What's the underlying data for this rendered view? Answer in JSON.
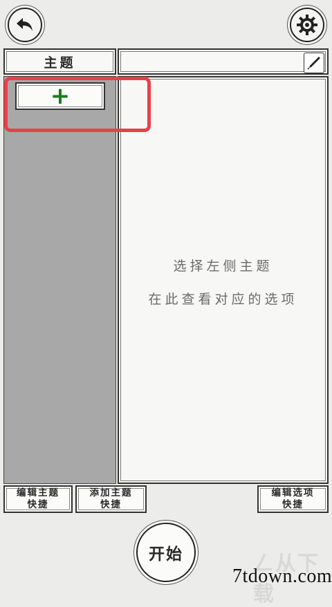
{
  "theme_panel": {
    "header": "主题",
    "add_button": "+"
  },
  "options_panel": {
    "hint_line1": "选择左侧主题",
    "hint_line2": "在此查看对应的选项"
  },
  "quick_buttons": {
    "edit_theme": {
      "line1": "编辑主题",
      "line2": "快捷"
    },
    "add_theme": {
      "line1": "添加主题",
      "line2": "快捷"
    },
    "edit_option": {
      "line1": "编辑选项",
      "line2": "快捷"
    }
  },
  "start_button": "开始",
  "watermark": {
    "text": "7tdown.com",
    "faint_text": "ㄥ从下载"
  },
  "colors": {
    "accent_green": "#1c7a1c",
    "highlight_red": "#e8404a",
    "list_bg": "#a8a8a8"
  },
  "icons": {
    "back": "back-arrow-icon",
    "settings": "gear-icon",
    "edit": "pen-icon"
  }
}
